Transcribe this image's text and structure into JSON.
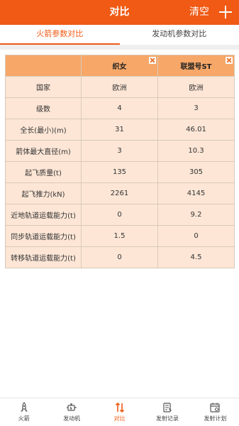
{
  "header": {
    "title": "对比",
    "clear_label": "清空"
  },
  "tabs": [
    {
      "label": "火箭参数对比",
      "active": true
    },
    {
      "label": "发动机参数对比",
      "active": false
    }
  ],
  "compare_table": {
    "columns": [
      "织女",
      "联盟号ST"
    ],
    "rows": [
      {
        "label": "国家",
        "values": [
          "欧洲",
          "欧洲"
        ]
      },
      {
        "label": "级数",
        "values": [
          "4",
          "3"
        ]
      },
      {
        "label": "全长(最小)(m)",
        "values": [
          "31",
          "46.01"
        ]
      },
      {
        "label": "箭体最大直径(m)",
        "values": [
          "3",
          "10.3"
        ]
      },
      {
        "label": "起飞质量(t)",
        "values": [
          "135",
          "305"
        ]
      },
      {
        "label": "起飞推力(kN)",
        "values": [
          "2261",
          "4145"
        ]
      },
      {
        "label": "近地轨道运载能力(t)",
        "values": [
          "0",
          "9.2"
        ]
      },
      {
        "label": "同步轨道运载能力(t)",
        "values": [
          "1.5",
          "0"
        ]
      },
      {
        "label": "转移轨道运载能力(t)",
        "values": [
          "0",
          "4.5"
        ]
      }
    ]
  },
  "bottom_nav": [
    {
      "label": "火箭",
      "icon": "rocket-icon",
      "active": false
    },
    {
      "label": "发动机",
      "icon": "engine-icon",
      "active": false
    },
    {
      "label": "对比",
      "icon": "compare-icon",
      "active": true
    },
    {
      "label": "发射记录",
      "icon": "record-icon",
      "active": false
    },
    {
      "label": "发射计划",
      "icon": "calendar-icon",
      "active": false
    }
  ],
  "colors": {
    "accent": "#f05a14",
    "header_cell": "#f7a869",
    "body_cell": "#fde6d6"
  }
}
